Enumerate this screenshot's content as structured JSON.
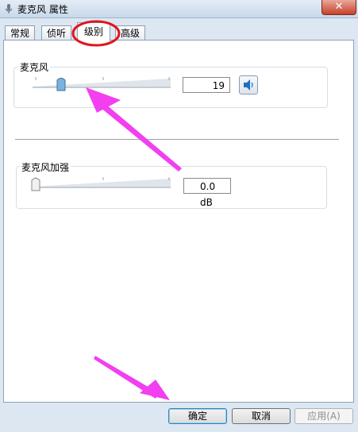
{
  "window": {
    "title": "麦克风 属性"
  },
  "tabs": [
    {
      "label": "常规"
    },
    {
      "label": "侦听"
    },
    {
      "label": "级别"
    },
    {
      "label": "高级"
    }
  ],
  "active_tab": "级别",
  "microphone": {
    "label": "麦克风",
    "value": "19",
    "level_percent": 19
  },
  "boost": {
    "label": "麦克风加强",
    "value": "0.0 dB",
    "level_percent": 0
  },
  "buttons": {
    "ok": "确定",
    "cancel": "取消",
    "apply": "应用(A)"
  },
  "colors": {
    "annotation": "#f23ff0",
    "highlight_circle": "#e0141e",
    "accent": "#3c7fb1"
  }
}
